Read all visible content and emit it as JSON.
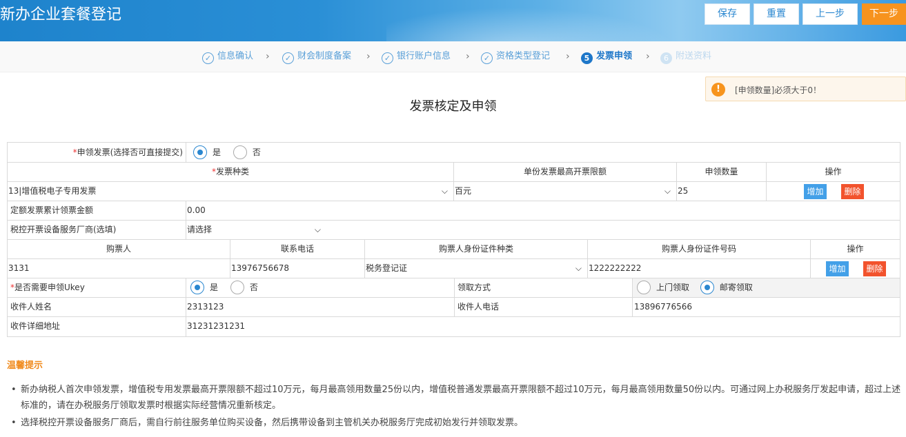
{
  "header": {
    "title": "新办企业套餐登记",
    "buttons": {
      "save": "保存",
      "reset": "重置",
      "prev": "上一步",
      "next": "下一步"
    }
  },
  "steps": [
    {
      "label": "信息确认",
      "icon": "check-circle-icon",
      "mark": "✓"
    },
    {
      "label": "财会制度备案",
      "icon": "check-circle-icon",
      "mark": "✓"
    },
    {
      "label": "银行账户信息",
      "icon": "check-circle-icon",
      "mark": "✓"
    },
    {
      "label": "资格类型登记",
      "icon": "check-circle-icon",
      "mark": "✓"
    },
    {
      "label": "发票申领",
      "icon": "step-number-icon",
      "mark": "5"
    },
    {
      "label": "附送资料",
      "icon": "step-number-icon",
      "mark": "6"
    }
  ],
  "toast": {
    "icon": "warning-icon",
    "mark": "!",
    "message": "[申领数量]必须大于0！"
  },
  "form": {
    "title": "发票核定及申领",
    "apply_invoice": {
      "required_mark": "*",
      "label": "申领发票(选择否可直接提交)",
      "options": [
        "是",
        "否"
      ],
      "selected": "是"
    },
    "invoice_table": {
      "headers": {
        "type": "发票种类",
        "type_required_mark": "*",
        "limit": "单份发票最高开票限额",
        "quantity": "申领数量",
        "actions": "操作"
      },
      "row": {
        "type": "13|增值税电子专用发票",
        "limit": "百元",
        "quantity": "25",
        "add": "增加",
        "delete": "删除"
      }
    },
    "fixed_amount": {
      "label": "定额发票累计领票金额",
      "value": "0.00"
    },
    "vendor": {
      "label": "税控开票设备服务厂商(选填)",
      "value": "请选择"
    },
    "buyer_table": {
      "headers": {
        "buyer": "购票人",
        "phone": "联系电话",
        "id_type": "购票人身份证件种类",
        "id_number": "购票人身份证件号码",
        "actions": "操作"
      },
      "row": {
        "buyer": "3131",
        "phone": "13976756678",
        "id_type": "税务登记证",
        "id_number": "1222222222",
        "add": "增加",
        "delete": "删除"
      }
    },
    "ukey": {
      "required_mark": "*",
      "label": "是否需要申领Ukey",
      "options": [
        "是",
        "否"
      ],
      "selected": "是"
    },
    "pickup": {
      "label": "领取方式",
      "options": [
        "上门领取",
        "邮寄领取"
      ],
      "selected": "邮寄领取"
    },
    "recipient_name": {
      "label": "收件人姓名",
      "value": "2313123"
    },
    "recipient_phone": {
      "label": "收件人电话",
      "value": "13896776566"
    },
    "recipient_address": {
      "label": "收件详细地址",
      "value": "31231231231"
    }
  },
  "tips": {
    "title": "温馨提示",
    "items": [
      "新办纳税人首次申领发票，增值税专用发票最高开票限额不超过10万元，每月最高领用数量25份以内，增值税普通发票最高开票限额不超过10万元，每月最高领用数量50份以内。可通过网上办税服务厅发起申请，超过上述标准的，请在办税服务厅领取发票时根据实际经营情况重新核定。",
      "选择税控开票设备服务厂商后，需自行前往服务单位购买设备，然后携带设备到主管机关办税服务厅完成初始发行并领取发票。"
    ]
  },
  "colors": {
    "header_blue": "#2a8fd6",
    "accent_orange": "#f7931e",
    "add_blue": "#43a0e8",
    "delete_red": "#f2532d",
    "tips_orange": "#f08a1c"
  }
}
